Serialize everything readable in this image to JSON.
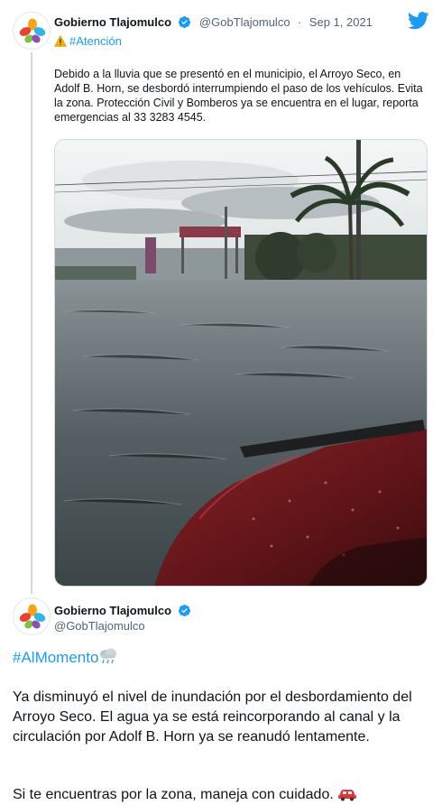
{
  "tweet1": {
    "display_name": "Gobierno Tlajomulco",
    "handle": "@GobTlajomulco",
    "separator": "·",
    "date": "Sep 1, 2021",
    "hashtag": "#Atención",
    "text": "Debido a la lluvia que se presentó en el municipio, el Arroyo Seco, en Adolf B. Horn, se desbordó interrumpiendo el paso de los vehículos. Evita la zona. Protección Civil y Bomberos ya se encuentra en el lugar, reporta emergencias al 33 3283 4545.",
    "icons": {
      "avatar": "tlajomulco-logo",
      "verified": "verified-badge-icon",
      "brand": "twitter-bird-icon",
      "warning": "warning-icon"
    }
  },
  "tweet2": {
    "display_name": "Gobierno Tlajomulco",
    "handle": "@GobTlajomulco",
    "hashtag": "#AlMomento",
    "text": "Ya disminuyó el nivel de inundación por el desbordamiento del Arroyo Seco. El agua ya se está reincorporando al canal y la circulación por Adolf B. Horn ya se reanudó lentamente.",
    "text_2": "Si te encuentras por la zona, maneja con cuidado.",
    "icons": {
      "hashtag_emoji": "cloud-rain-icon",
      "end_emoji": "car-icon"
    }
  },
  "colors": {
    "link": "#1d9bf0",
    "text": "#0f1419",
    "muted": "#536471",
    "verified": "#1d9bf0"
  }
}
